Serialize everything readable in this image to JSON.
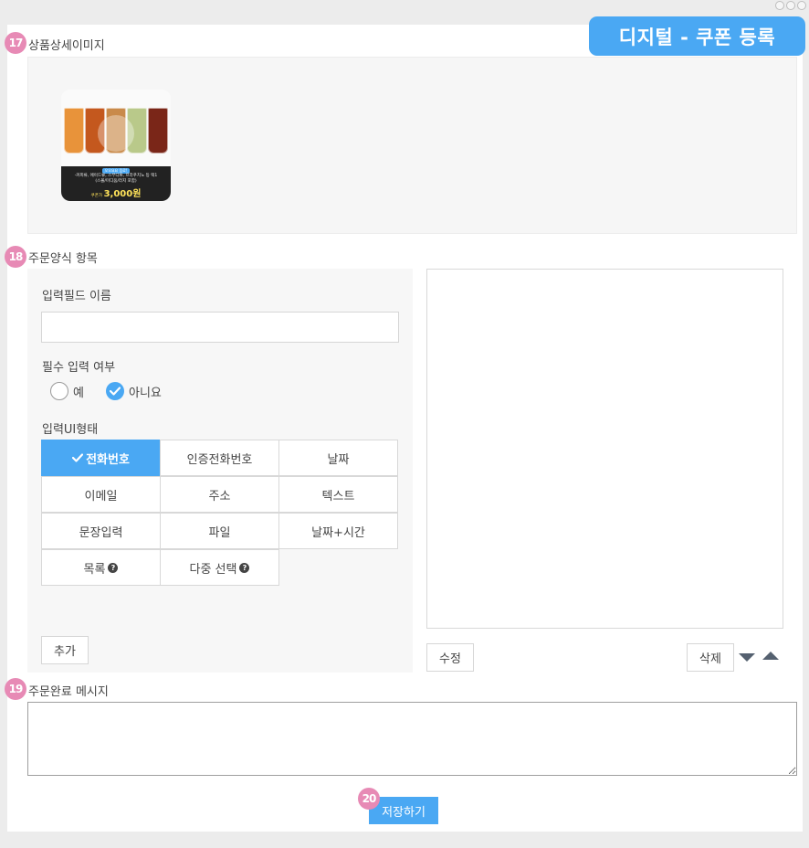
{
  "header": {
    "title": "디지털 - 쿠폰 등록"
  },
  "sections": {
    "s17": {
      "number": "17",
      "label": "상품상세이미지"
    },
    "s18": {
      "number": "18",
      "label": "주문양식 항목"
    },
    "s19": {
      "number": "19",
      "label": "주문완료 메시지"
    },
    "s20": {
      "number": "20"
    }
  },
  "product_image": {
    "tag": "오오요요 음료!",
    "line1": "-커피류, 에이드류, 스무디류, 프라푸치노 등 택1",
    "line2": "(스몰/미디움/라지 포함)",
    "price_label": "쿠폰가",
    "price": "3,000원",
    "glass_colors": [
      "#e8933a",
      "#c4581e",
      "#c98a4a",
      "#b9c98a",
      "#7a2618"
    ]
  },
  "order_form": {
    "field_name_label": "입력필드 이름",
    "field_name_value": "",
    "required_label": "필수 입력 여부",
    "radio_yes": "예",
    "radio_no": "아니요",
    "required_selected": "아니요",
    "ui_type_label": "입력UI형태",
    "ui_types": [
      "전화번호",
      "인증전화번호",
      "날짜",
      "이메일",
      "주소",
      "텍스트",
      "문장입력",
      "파일",
      "날짜+시간",
      "목록",
      "다중 선택"
    ],
    "ui_type_selected": "전화번호",
    "add_button": "추가"
  },
  "list_panel": {
    "edit_button": "수정",
    "delete_button": "삭제"
  },
  "complete_message": {
    "value": ""
  },
  "save_button": "저장하기",
  "colors": {
    "accent": "#4aa8f3",
    "badge": "#e78ab5",
    "arrow": "#556170"
  },
  "icons": [
    "check-icon",
    "question-icon",
    "arrow-down-icon",
    "arrow-up-icon"
  ]
}
